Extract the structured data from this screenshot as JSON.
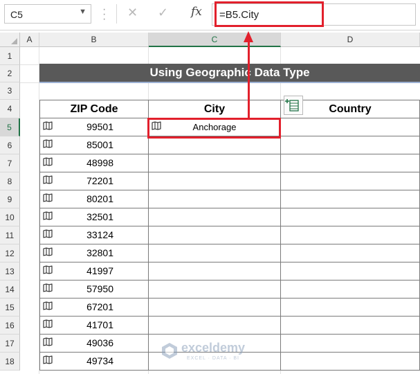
{
  "formula_bar": {
    "name_box": "C5",
    "cancel_icon": "x-icon",
    "enter_icon": "check-icon",
    "fx_label": "fx",
    "formula": "=B5.City"
  },
  "columns": [
    "A",
    "B",
    "C",
    "D"
  ],
  "rows": [
    "1",
    "2",
    "3",
    "4",
    "5",
    "6",
    "7",
    "8",
    "9",
    "10",
    "11",
    "12",
    "13",
    "14",
    "15",
    "16",
    "17",
    "18"
  ],
  "title": "Using Geographic Data Type",
  "table": {
    "headers": [
      "ZIP Code",
      "City",
      "Country"
    ],
    "rows": [
      {
        "zip": "99501",
        "city": "Anchorage",
        "country": ""
      },
      {
        "zip": "85001",
        "city": "",
        "country": ""
      },
      {
        "zip": "48998",
        "city": "",
        "country": ""
      },
      {
        "zip": "72201",
        "city": "",
        "country": ""
      },
      {
        "zip": "80201",
        "city": "",
        "country": ""
      },
      {
        "zip": "32501",
        "city": "",
        "country": ""
      },
      {
        "zip": "33124",
        "city": "",
        "country": ""
      },
      {
        "zip": "32801",
        "city": "",
        "country": ""
      },
      {
        "zip": "41997",
        "city": "",
        "country": ""
      },
      {
        "zip": "57950",
        "city": "",
        "country": ""
      },
      {
        "zip": "67201",
        "city": "",
        "country": ""
      },
      {
        "zip": "41701",
        "city": "",
        "country": ""
      },
      {
        "zip": "49036",
        "city": "",
        "country": ""
      },
      {
        "zip": "49734",
        "city": "",
        "country": ""
      }
    ]
  },
  "watermark": {
    "name": "exceldemy",
    "tagline": "EXCEL · DATA · BI"
  },
  "colors": {
    "highlight": "#e2202c",
    "title_bg": "#595959",
    "selected_header": "#217346"
  }
}
